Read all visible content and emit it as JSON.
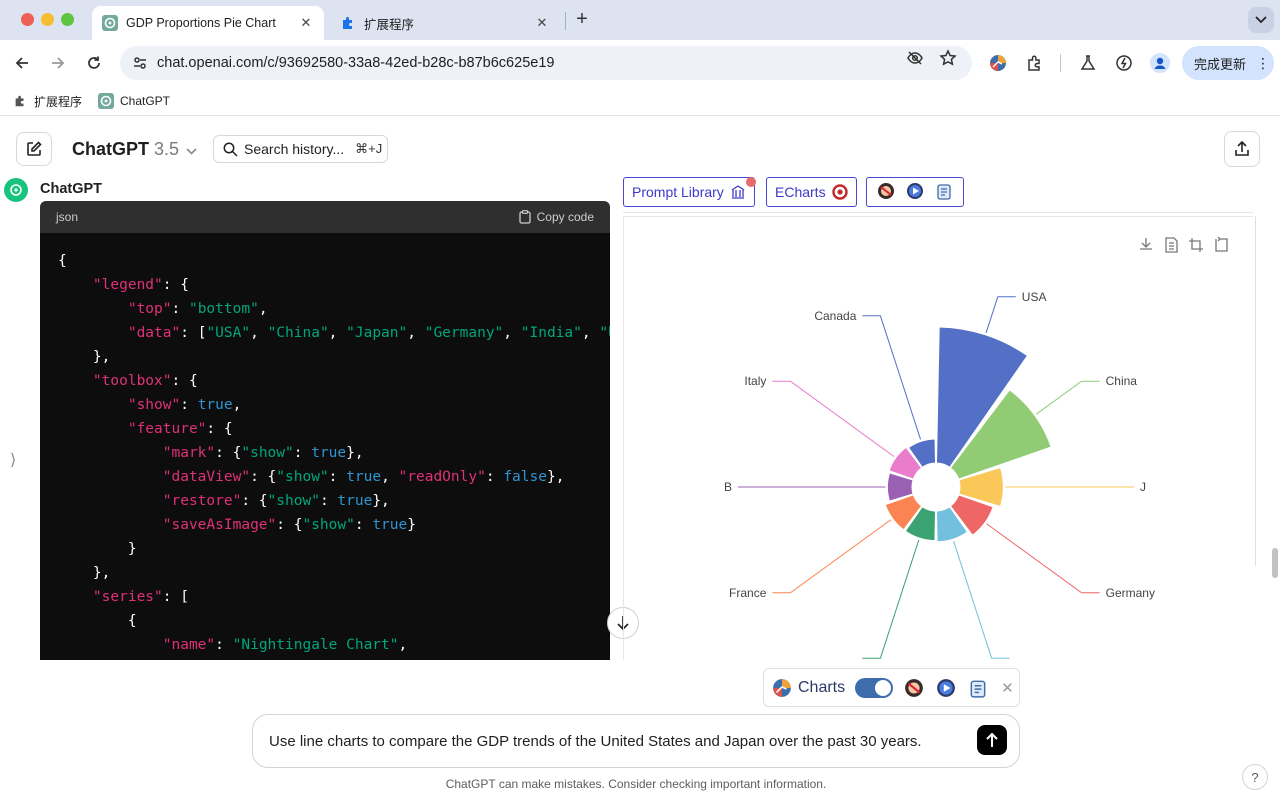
{
  "browser": {
    "tabs": [
      {
        "title": "GDP Proportions Pie Chart",
        "close": "✕",
        "icon": "openai-icon"
      },
      {
        "title": "扩展程序",
        "close": "✕",
        "icon": "puzzle-icon"
      }
    ],
    "new_tab": "+",
    "url": "chat.openai.com/c/93692580-33a8-42ed-b28c-b87b6c625e19",
    "update_button": "完成更新",
    "update_menu": "⋮",
    "bookmarks": [
      {
        "label": "扩展程序",
        "icon": "puzzle-icon"
      },
      {
        "label": "ChatGPT",
        "icon": "openai-icon"
      }
    ]
  },
  "header": {
    "model_name": "ChatGPT",
    "model_version": "3.5",
    "search_label": "Search history...",
    "search_shortcut": "⌘+J"
  },
  "message": {
    "author": "ChatGPT",
    "code_language": "json",
    "copy_label": "Copy code",
    "code_lines": [
      [
        {
          "t": "{",
          "c": "p"
        }
      ],
      [
        {
          "t": "    ",
          "c": "p"
        },
        {
          "t": "\"legend\"",
          "c": "key"
        },
        {
          "t": ": {",
          "c": "p"
        }
      ],
      [
        {
          "t": "        ",
          "c": "p"
        },
        {
          "t": "\"top\"",
          "c": "key"
        },
        {
          "t": ": ",
          "c": "p"
        },
        {
          "t": "\"bottom\"",
          "c": "str"
        },
        {
          "t": ",",
          "c": "p"
        }
      ],
      [
        {
          "t": "        ",
          "c": "p"
        },
        {
          "t": "\"data\"",
          "c": "key"
        },
        {
          "t": ": [",
          "c": "p"
        },
        {
          "t": "\"USA\"",
          "c": "str"
        },
        {
          "t": ", ",
          "c": "p"
        },
        {
          "t": "\"China\"",
          "c": "str"
        },
        {
          "t": ", ",
          "c": "p"
        },
        {
          "t": "\"Japan\"",
          "c": "str"
        },
        {
          "t": ", ",
          "c": "p"
        },
        {
          "t": "\"Germany\"",
          "c": "str"
        },
        {
          "t": ", ",
          "c": "p"
        },
        {
          "t": "\"India\"",
          "c": "str"
        },
        {
          "t": ", ",
          "c": "p"
        },
        {
          "t": "\"UK\"",
          "c": "str"
        }
      ],
      [
        {
          "t": "    },",
          "c": "p"
        }
      ],
      [
        {
          "t": "    ",
          "c": "p"
        },
        {
          "t": "\"toolbox\"",
          "c": "key"
        },
        {
          "t": ": {",
          "c": "p"
        }
      ],
      [
        {
          "t": "        ",
          "c": "p"
        },
        {
          "t": "\"show\"",
          "c": "key"
        },
        {
          "t": ": ",
          "c": "p"
        },
        {
          "t": "true",
          "c": "kw"
        },
        {
          "t": ",",
          "c": "p"
        }
      ],
      [
        {
          "t": "        ",
          "c": "p"
        },
        {
          "t": "\"feature\"",
          "c": "key"
        },
        {
          "t": ": {",
          "c": "p"
        }
      ],
      [
        {
          "t": "            ",
          "c": "p"
        },
        {
          "t": "\"mark\"",
          "c": "key"
        },
        {
          "t": ": {",
          "c": "p"
        },
        {
          "t": "\"show\"",
          "c": "str"
        },
        {
          "t": ": ",
          "c": "p"
        },
        {
          "t": "true",
          "c": "kw"
        },
        {
          "t": "},",
          "c": "p"
        }
      ],
      [
        {
          "t": "            ",
          "c": "p"
        },
        {
          "t": "\"dataView\"",
          "c": "key"
        },
        {
          "t": ": {",
          "c": "p"
        },
        {
          "t": "\"show\"",
          "c": "str"
        },
        {
          "t": ": ",
          "c": "p"
        },
        {
          "t": "true",
          "c": "kw"
        },
        {
          "t": ", ",
          "c": "p"
        },
        {
          "t": "\"readOnly\"",
          "c": "key"
        },
        {
          "t": ": ",
          "c": "p"
        },
        {
          "t": "false",
          "c": "kw"
        },
        {
          "t": "},",
          "c": "p"
        }
      ],
      [
        {
          "t": "            ",
          "c": "p"
        },
        {
          "t": "\"restore\"",
          "c": "key"
        },
        {
          "t": ": {",
          "c": "p"
        },
        {
          "t": "\"show\"",
          "c": "str"
        },
        {
          "t": ": ",
          "c": "p"
        },
        {
          "t": "true",
          "c": "kw"
        },
        {
          "t": "},",
          "c": "p"
        }
      ],
      [
        {
          "t": "            ",
          "c": "p"
        },
        {
          "t": "\"saveAsImage\"",
          "c": "key"
        },
        {
          "t": ": {",
          "c": "p"
        },
        {
          "t": "\"show\"",
          "c": "str"
        },
        {
          "t": ": ",
          "c": "p"
        },
        {
          "t": "true",
          "c": "kw"
        },
        {
          "t": "}",
          "c": "p"
        }
      ],
      [
        {
          "t": "        }",
          "c": "p"
        }
      ],
      [
        {
          "t": "    },",
          "c": "p"
        }
      ],
      [
        {
          "t": "    ",
          "c": "p"
        },
        {
          "t": "\"series\"",
          "c": "key"
        },
        {
          "t": ": [",
          "c": "p"
        }
      ],
      [
        {
          "t": "        {",
          "c": "p"
        }
      ],
      [
        {
          "t": "            ",
          "c": "p"
        },
        {
          "t": "\"name\"",
          "c": "key"
        },
        {
          "t": ": ",
          "c": "p"
        },
        {
          "t": "\"Nightingale Chart\"",
          "c": "str"
        },
        {
          "t": ",",
          "c": "p"
        }
      ]
    ]
  },
  "panel": {
    "buttons": [
      {
        "label": "Prompt Library",
        "icon": "library-icon"
      },
      {
        "label": "ECharts",
        "icon": "echarts-icon"
      }
    ],
    "toolbox_icons": [
      "download-icon",
      "data-view-icon",
      "zoom-select-icon",
      "restore-icon"
    ]
  },
  "chart_data": {
    "type": "pie",
    "rose_type": "radius",
    "categories": [
      "USA",
      "China",
      "J",
      "Germany",
      "",
      "",
      "France",
      "B",
      "Italy",
      "Canada"
    ],
    "labels_shown": [
      "USA",
      "China",
      "J",
      "Germany",
      "France",
      "B",
      "Italy",
      "Canada"
    ],
    "values": [
      21.4,
      14.7,
      5.1,
      3.9,
      2.9,
      2.7,
      2.7,
      1.8,
      2.0,
      1.7
    ],
    "colors": [
      "#5470c6",
      "#91cc75",
      "#fac858",
      "#ee6666",
      "#73c0de",
      "#3ba272",
      "#fc8452",
      "#9a60b4",
      "#ea7ccc",
      "#5470c6"
    ],
    "legend": "bottom"
  },
  "bottom": {
    "charts_label": "Charts",
    "charts_toggle_on": true,
    "close": "✕",
    "input_text": "Use line charts to compare the GDP trends of the United States and Japan over the past 30 years.",
    "disclaimer": "ChatGPT can make mistakes. Consider checking important information.",
    "help": "?"
  }
}
